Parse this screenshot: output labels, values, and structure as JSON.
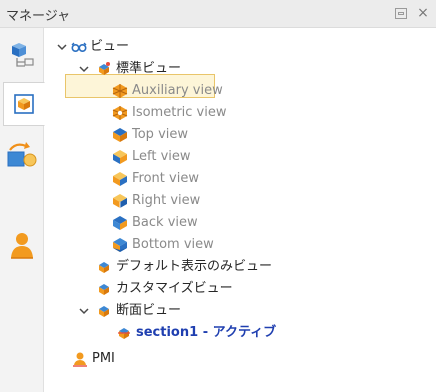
{
  "window": {
    "title": "マネージャ",
    "pin_icon": "pin-icon",
    "close_icon": "close-icon",
    "close_glyph": "×"
  },
  "side_tabs": [
    {
      "icon": "structure-tree-icon"
    },
    {
      "icon": "view-cube-icon",
      "active": true
    },
    {
      "icon": "transfer-icon"
    },
    {
      "icon": "person-icon"
    }
  ],
  "tree": {
    "root": {
      "label": "ビュー",
      "icon": "glasses-icon",
      "expanded": true
    },
    "standard": {
      "label": "標準ビュー",
      "icon": "standard-view-icon",
      "expanded": true
    },
    "views": [
      {
        "label": "Auxiliary view",
        "icon": "auxiliary-view-icon"
      },
      {
        "label": "Isometric view",
        "icon": "isometric-view-icon",
        "selected": true
      },
      {
        "label": "Top view",
        "icon": "top-view-icon"
      },
      {
        "label": "Left view",
        "icon": "left-view-icon"
      },
      {
        "label": "Front view",
        "icon": "front-view-icon"
      },
      {
        "label": "Right view",
        "icon": "right-view-icon"
      },
      {
        "label": "Back view",
        "icon": "back-view-icon"
      },
      {
        "label": "Bottom view",
        "icon": "bottom-view-icon"
      }
    ],
    "default_display": {
      "label": "デフォルト表示のみビュー",
      "icon": "view-icon"
    },
    "customize": {
      "label": "カスタマイズビュー",
      "icon": "view-icon"
    },
    "section": {
      "label": "断面ビュー",
      "icon": "view-icon",
      "expanded": true
    },
    "section_item": {
      "label": "section1 - アクティブ",
      "icon": "section-view-icon"
    },
    "pmi": {
      "label": "PMI",
      "icon": "pmi-icon"
    }
  },
  "colors": {
    "cube_orange": "#f29a1f",
    "cube_blue": "#1f6fc7",
    "cube_light": "#f7c65a",
    "active_text": "#1f3fb0",
    "selection_bg": "#fdf5d8",
    "selection_border": "#e9c56a"
  }
}
